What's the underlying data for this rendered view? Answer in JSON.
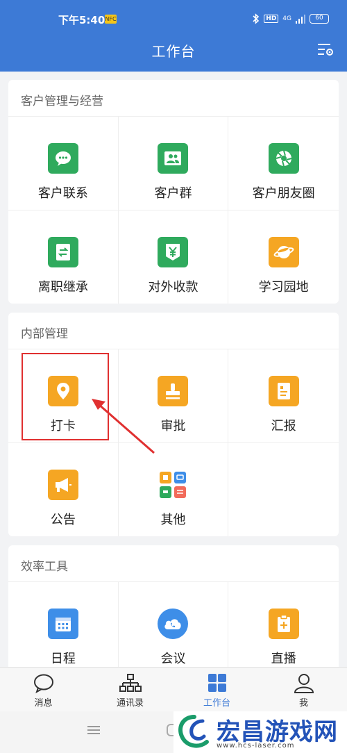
{
  "status_bar": {
    "time": "下午5:40",
    "badge": "NFC",
    "hd": "HD",
    "network": "4G",
    "battery": "60"
  },
  "header": {
    "title": "工作台"
  },
  "sections": [
    {
      "title": "客户管理与经营",
      "items": [
        {
          "label": "客户联系",
          "icon": "chat-icon",
          "color": "#2faa5d"
        },
        {
          "label": "客户群",
          "icon": "group-icon",
          "color": "#2faa5d"
        },
        {
          "label": "客户朋友圈",
          "icon": "aperture-icon",
          "color": "#2faa5d"
        },
        {
          "label": "离职继承",
          "icon": "transfer-doc-icon",
          "color": "#2faa5d"
        },
        {
          "label": "对外收款",
          "icon": "yuan-shield-icon",
          "color": "#2faa5d"
        },
        {
          "label": "学习园地",
          "icon": "planet-icon",
          "color": "#f5a623"
        }
      ]
    },
    {
      "title": "内部管理",
      "items": [
        {
          "label": "打卡",
          "icon": "location-pin-icon",
          "color": "#f5a623"
        },
        {
          "label": "审批",
          "icon": "stamp-icon",
          "color": "#f5a623"
        },
        {
          "label": "汇报",
          "icon": "report-icon",
          "color": "#f5a623"
        },
        {
          "label": "公告",
          "icon": "megaphone-icon",
          "color": "#f5a623"
        },
        {
          "label": "其他",
          "icon": "apps-grid-icon",
          "color": "#ffffff"
        }
      ]
    },
    {
      "title": "效率工具",
      "items": [
        {
          "label": "日程",
          "icon": "calendar-icon",
          "color": "#3e8ee8"
        },
        {
          "label": "会议",
          "icon": "phone-cloud-icon",
          "color": "#3e8ee8"
        },
        {
          "label": "直播",
          "icon": "clipboard-plus-icon",
          "color": "#f5a623"
        }
      ]
    }
  ],
  "tabs": [
    {
      "label": "消息",
      "icon": "message-icon"
    },
    {
      "label": "通讯录",
      "icon": "org-chart-icon"
    },
    {
      "label": "工作台",
      "icon": "workbench-icon",
      "active": true
    },
    {
      "label": "我",
      "icon": "person-icon"
    }
  ],
  "watermark": {
    "text": "宏昌游戏网",
    "url": "www.hcs-laser.com"
  }
}
